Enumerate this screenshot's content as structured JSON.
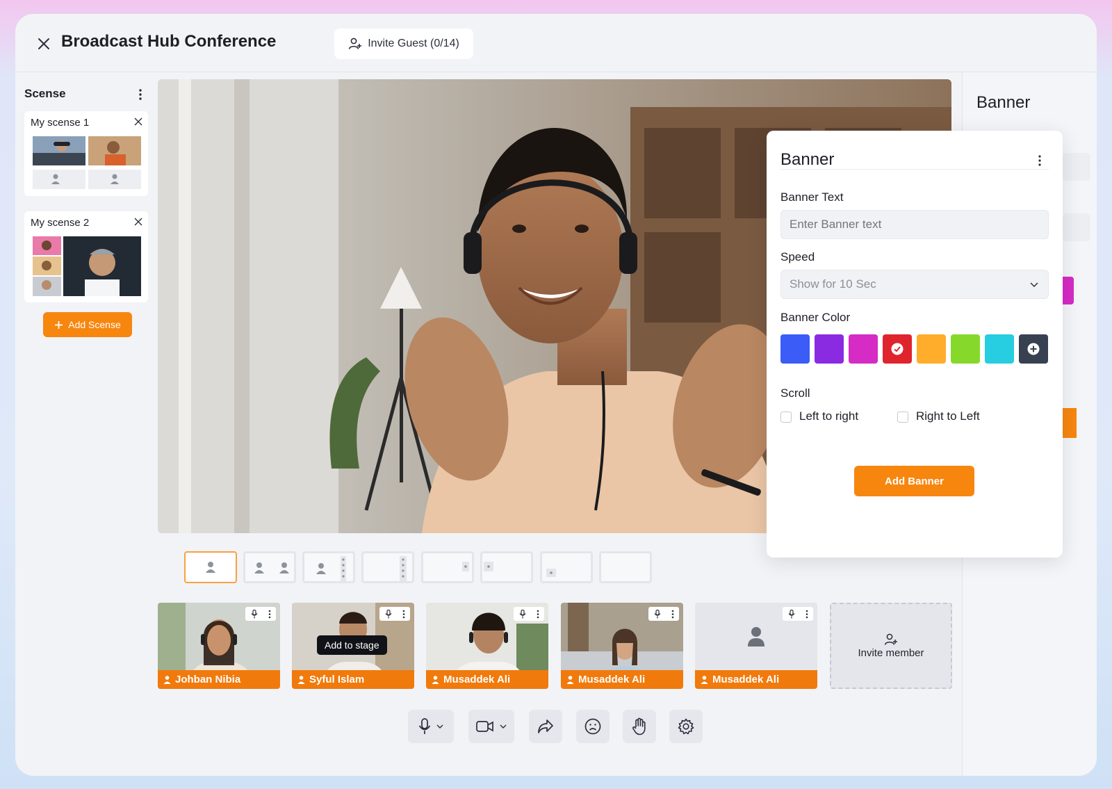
{
  "app": {
    "title": "Broadcast Hub Conference",
    "invite_guest": "Invite Guest (0/14)"
  },
  "scenes": {
    "title": "Scense",
    "items": [
      {
        "label": "My scense 1"
      },
      {
        "label": "My scense 2"
      }
    ],
    "add_label": "Add Scense"
  },
  "tooltip": "Add to stage",
  "participants": [
    {
      "name": "Johban Nibia"
    },
    {
      "name": "Syful Islam"
    },
    {
      "name": "Musaddek Ali"
    },
    {
      "name": "Musaddek Ali"
    },
    {
      "name": "Musaddek Ali"
    }
  ],
  "invite_member": "Invite member",
  "right_panel": {
    "title": "Banner"
  },
  "banner": {
    "title": "Banner",
    "text_label": "Banner Text",
    "text_placeholder": "Enter Banner text",
    "speed_label": "Speed",
    "speed_value": "Show for 10 Sec",
    "color_label": "Banner Color",
    "colors": [
      "#3b5cf6",
      "#8a2be2",
      "#d62bc5",
      "#e0242e",
      "#ffad2b",
      "#86d92b",
      "#27cde0"
    ],
    "selected_color": "#e0242e",
    "add_color_swatch": "#374151",
    "scroll_label": "Scroll",
    "scroll_options": [
      "Left to right",
      "Right to Left"
    ],
    "add_label": "Add Banner"
  },
  "colors": {
    "accent": "#f7860f",
    "name_bar": "#f17a0c"
  },
  "toolbar": [
    "mic-icon",
    "camera-icon",
    "share-icon",
    "emoji-icon",
    "hand-icon",
    "settings-icon"
  ]
}
